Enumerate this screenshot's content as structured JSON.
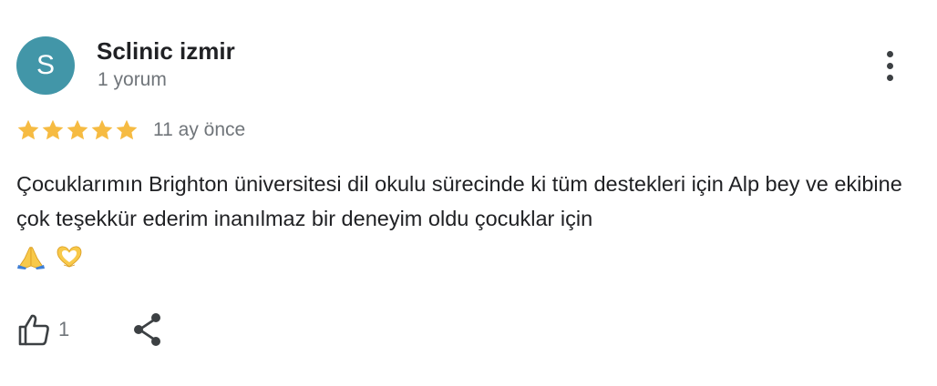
{
  "reviewer": {
    "initial": "S",
    "name": "Sclinic izmir",
    "review_count": "1 yorum",
    "avatar_color": "#4296a8"
  },
  "review": {
    "rating": 5,
    "rating_max": 5,
    "star_color": "#f6bb42",
    "date": "11 ay önce",
    "text": "Çocuklarımın Brighton üniversitesi dil okulu sürecinde ki tüm destekleri için Alp bey ve ekibine çok teşekkür ederim inanılmaz bir deneyim oldu çocuklar için",
    "emojis": [
      "folded-hands-emoji",
      "heart-hands-emoji"
    ]
  },
  "actions": {
    "like_count": "1",
    "like_icon": "thumbs-up-icon",
    "share_icon": "share-icon",
    "more_icon": "more-vertical-icon"
  }
}
